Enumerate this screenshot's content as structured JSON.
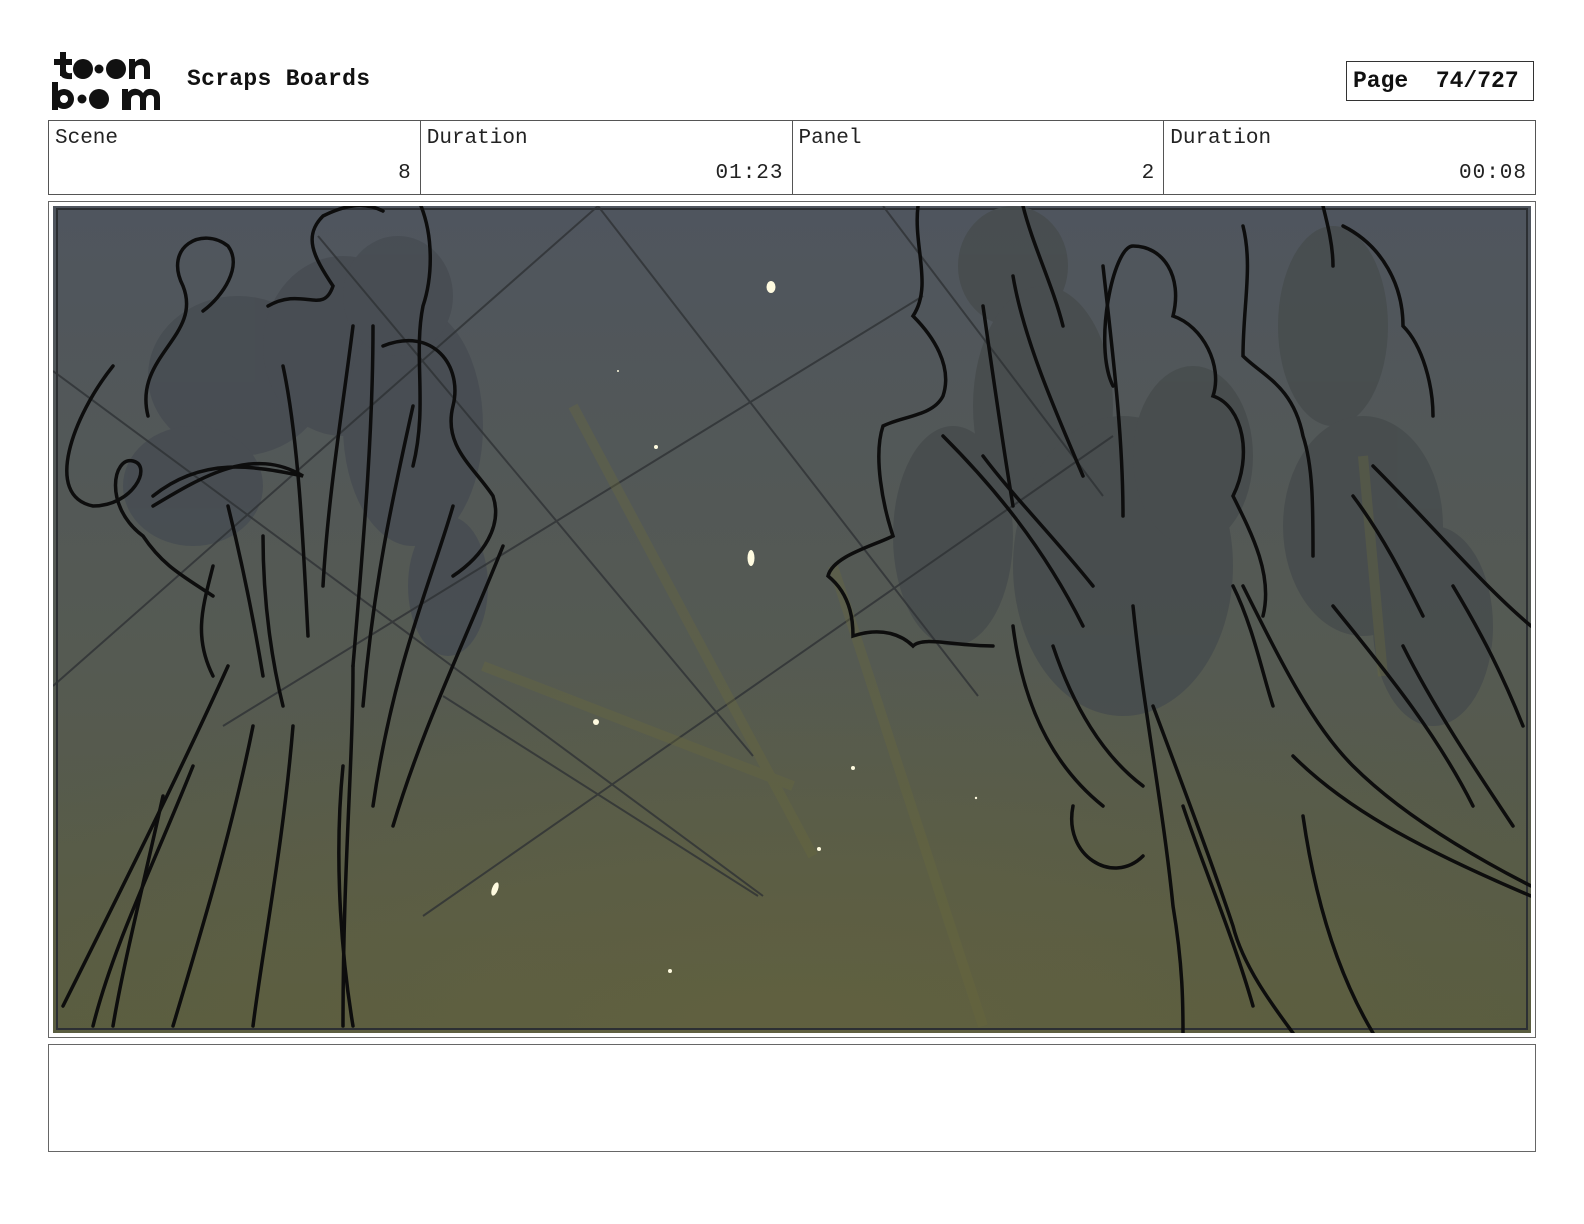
{
  "header": {
    "logo_text_top": "toon",
    "logo_text_bottom": "boom",
    "project_title": "Scraps Boards",
    "page_label": "Page",
    "page_value": "74/727"
  },
  "info": {
    "scene_label": "Scene",
    "scene_value": "8",
    "scene_duration_label": "Duration",
    "scene_duration_value": "01:23",
    "panel_label": "Panel",
    "panel_value": "2",
    "panel_duration_label": "Duration",
    "panel_duration_value": "00:08"
  },
  "notes": {
    "text": ""
  },
  "colors": {
    "sky_top": "#505660",
    "sky_bottom": "#575c44",
    "line_ink": "#0d0d0d",
    "spark": "#fffbe0"
  }
}
